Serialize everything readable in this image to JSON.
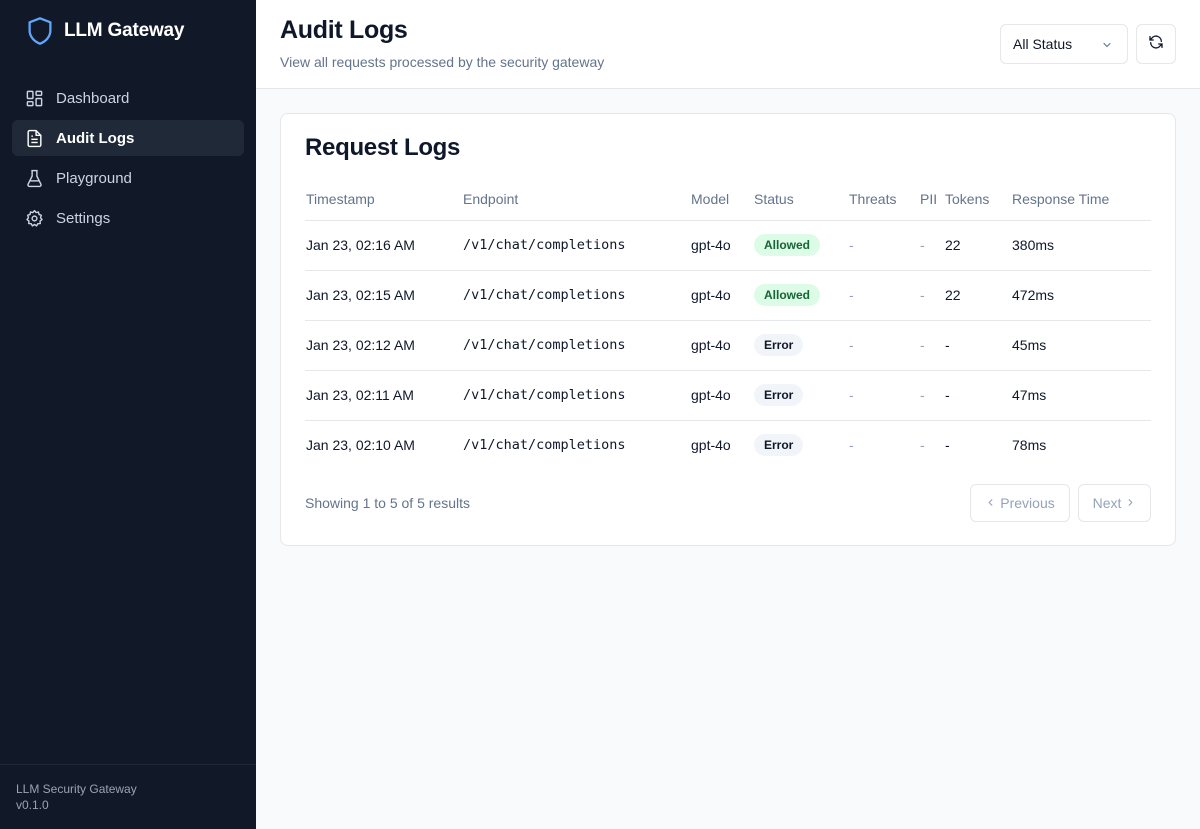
{
  "sidebar": {
    "brand": "LLM Gateway",
    "items": [
      {
        "label": "Dashboard",
        "icon": "dashboard-icon",
        "active": false
      },
      {
        "label": "Audit Logs",
        "icon": "file-text-icon",
        "active": true
      },
      {
        "label": "Playground",
        "icon": "flask-icon",
        "active": false
      },
      {
        "label": "Settings",
        "icon": "gear-icon",
        "active": false
      }
    ],
    "footer": {
      "name": "LLM Security Gateway",
      "version": "v0.1.0"
    }
  },
  "header": {
    "title": "Audit Logs",
    "subtitle": "View all requests processed by the security gateway",
    "status_filter": "All Status"
  },
  "logs": {
    "title": "Request Logs",
    "columns": [
      "Timestamp",
      "Endpoint",
      "Model",
      "Status",
      "Threats",
      "PII",
      "Tokens",
      "Response Time"
    ],
    "rows": [
      {
        "timestamp": "Jan 23, 02:16 AM",
        "endpoint": "/v1/chat/completions",
        "model": "gpt-4o",
        "status": "Allowed",
        "threats": "-",
        "pii": "-",
        "tokens": "22",
        "response_time": "380ms"
      },
      {
        "timestamp": "Jan 23, 02:15 AM",
        "endpoint": "/v1/chat/completions",
        "model": "gpt-4o",
        "status": "Allowed",
        "threats": "-",
        "pii": "-",
        "tokens": "22",
        "response_time": "472ms"
      },
      {
        "timestamp": "Jan 23, 02:12 AM",
        "endpoint": "/v1/chat/completions",
        "model": "gpt-4o",
        "status": "Error",
        "threats": "-",
        "pii": "-",
        "tokens": "-",
        "response_time": "45ms"
      },
      {
        "timestamp": "Jan 23, 02:11 AM",
        "endpoint": "/v1/chat/completions",
        "model": "gpt-4o",
        "status": "Error",
        "threats": "-",
        "pii": "-",
        "tokens": "-",
        "response_time": "47ms"
      },
      {
        "timestamp": "Jan 23, 02:10 AM",
        "endpoint": "/v1/chat/completions",
        "model": "gpt-4o",
        "status": "Error",
        "threats": "-",
        "pii": "-",
        "tokens": "-",
        "response_time": "78ms"
      }
    ],
    "results_text": "Showing 1 to 5 of 5 results",
    "prev_label": "Previous",
    "next_label": "Next"
  },
  "colors": {
    "sidebar_bg": "#111827",
    "brand_icon": "#60a5fa",
    "allowed_bg": "#dcfce7",
    "allowed_text": "#166534",
    "error_bg": "#f1f5f9"
  }
}
